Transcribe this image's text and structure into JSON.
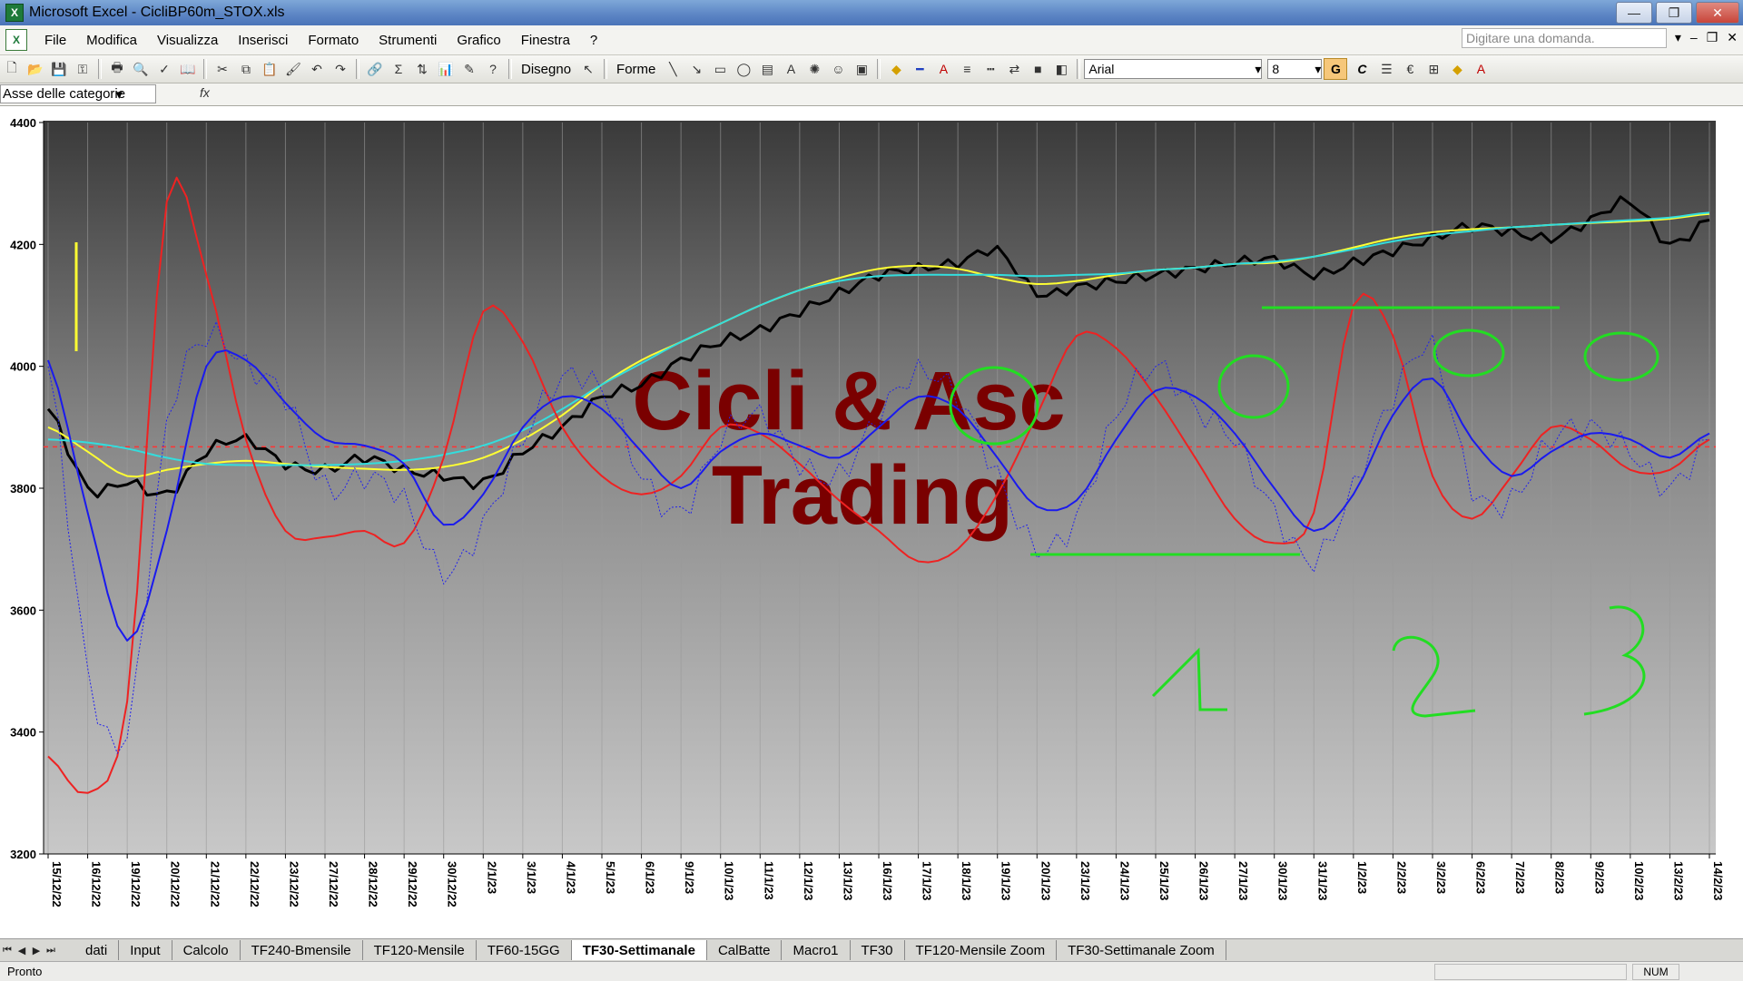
{
  "window": {
    "title": "Microsoft Excel - CicliBP60m_STOX.xls",
    "app_icon_letter": "X",
    "buttons": {
      "minimize": "—",
      "restore": "❐",
      "close": "✕"
    }
  },
  "menubar": {
    "items": [
      "File",
      "Modifica",
      "Visualizza",
      "Inserisci",
      "Formato",
      "Strumenti",
      "Grafico",
      "Finestra",
      "?"
    ],
    "question_placeholder": "Digitare una domanda.",
    "mdi_buttons": [
      "▾",
      "–",
      "❐",
      "✕"
    ]
  },
  "toolbar": {
    "draw_label": "Disegno",
    "shapes_label": "Forme",
    "font_name": "Arial",
    "font_size": "8",
    "bold_label": "G",
    "italic_label": "C",
    "euro_label": "€"
  },
  "formula_bar": {
    "name_box": "Asse delle categorie",
    "fx_label": "fx"
  },
  "chart_data": {
    "type": "line",
    "title": "",
    "watermark_lines": [
      "Cicli & Asc",
      "Trading"
    ],
    "ylim": [
      3200,
      4400
    ],
    "y_ticks": [
      "4400",
      "4200",
      "4000",
      "3800",
      "3600",
      "3400",
      "3200"
    ],
    "x_labels": [
      "15/12/22",
      "16/12/22",
      "19/12/22",
      "20/12/22",
      "21/12/22",
      "22/12/22",
      "23/12/22",
      "27/12/22",
      "28/12/22",
      "29/12/22",
      "30/12/22",
      "2/1/23",
      "3/1/23",
      "4/1/23",
      "5/1/23",
      "6/1/23",
      "9/1/23",
      "10/1/23",
      "11/1/23",
      "12/1/23",
      "13/1/23",
      "16/1/23",
      "17/1/23",
      "18/1/23",
      "19/1/23",
      "20/1/23",
      "23/1/23",
      "24/1/23",
      "25/1/23",
      "26/1/23",
      "27/1/23",
      "30/1/23",
      "31/1/23",
      "1/2/23",
      "2/2/23",
      "3/2/23",
      "6/2/23",
      "7/2/23",
      "8/2/23",
      "9/2/23",
      "10/2/23",
      "13/2/23",
      "14/2/23"
    ],
    "reference_line": 3868,
    "series": [
      {
        "color": "#000000",
        "style": "thick",
        "values": [
          3930,
          3800,
          3810,
          3790,
          3860,
          3880,
          3840,
          3830,
          3850,
          3830,
          3820,
          3810,
          3860,
          3900,
          3950,
          3970,
          4010,
          4040,
          4060,
          4090,
          4120,
          4150,
          4160,
          4170,
          4190,
          4120,
          4130,
          4140,
          4150,
          4160,
          4170,
          4175,
          4150,
          4170,
          4190,
          4210,
          4230,
          4220,
          4210,
          4240,
          4270,
          4200,
          4240
        ]
      },
      {
        "color": "#ffff33",
        "style": "smooth",
        "values": [
          3900,
          3860,
          3820,
          3830,
          3840,
          3845,
          3840,
          3835,
          3832,
          3830,
          3835,
          3850,
          3880,
          3920,
          3970,
          4010,
          4040,
          4070,
          4100,
          4125,
          4145,
          4160,
          4165,
          4160,
          4145,
          4135,
          4140,
          4150,
          4158,
          4162,
          4168,
          4170,
          4180,
          4195,
          4210,
          4220,
          4225,
          4228,
          4232,
          4235,
          4238,
          4242,
          4250
        ]
      },
      {
        "color": "#33dddd",
        "style": "smooth",
        "values": [
          3880,
          3875,
          3865,
          3850,
          3840,
          3838,
          3838,
          3838,
          3840,
          3845,
          3855,
          3870,
          3895,
          3930,
          3970,
          4005,
          4040,
          4070,
          4100,
          4125,
          4140,
          4148,
          4150,
          4150,
          4150,
          4148,
          4150,
          4152,
          4158,
          4162,
          4168,
          4172,
          4180,
          4192,
          4205,
          4215,
          4222,
          4228,
          4232,
          4236,
          4240,
          4244,
          4252
        ]
      },
      {
        "color": "#ee2222",
        "style": "normal",
        "values": [
          3360,
          3300,
          3450,
          4270,
          4150,
          3880,
          3730,
          3720,
          3730,
          3710,
          3850,
          4090,
          4040,
          3900,
          3820,
          3790,
          3820,
          3900,
          3890,
          3840,
          3780,
          3730,
          3680,
          3700,
          3790,
          3920,
          4050,
          4030,
          3950,
          3850,
          3750,
          3710,
          3760,
          4100,
          4050,
          3820,
          3750,
          3820,
          3900,
          3880,
          3830,
          3830,
          3880
        ]
      },
      {
        "color": "#1a1aee",
        "style": "normal",
        "values": [
          4010,
          3760,
          3550,
          3730,
          4000,
          4010,
          3940,
          3880,
          3870,
          3840,
          3740,
          3790,
          3900,
          3950,
          3930,
          3860,
          3800,
          3860,
          3890,
          3870,
          3850,
          3900,
          3950,
          3930,
          3850,
          3770,
          3780,
          3880,
          3960,
          3950,
          3890,
          3800,
          3730,
          3790,
          3920,
          3980,
          3880,
          3820,
          3860,
          3890,
          3880,
          3850,
          3890
        ]
      },
      {
        "color": "#2222ee",
        "style": "dotted",
        "values": [
          4000,
          3500,
          3400,
          3900,
          4050,
          4000,
          3950,
          3800,
          3820,
          3780,
          3660,
          3740,
          3880,
          3980,
          3960,
          3820,
          3760,
          3880,
          3920,
          3840,
          3820,
          3920,
          3990,
          3950,
          3820,
          3700,
          3750,
          3920,
          4000,
          3930,
          3880,
          3760,
          3680,
          3800,
          3950,
          4030,
          3800,
          3780,
          3880,
          3900,
          3860,
          3800,
          3880
        ]
      }
    ],
    "annotations": [
      {
        "text": "1",
        "color": "#22dd22"
      },
      {
        "text": "2",
        "color": "#22dd22"
      },
      {
        "text": "3",
        "color": "#22dd22"
      }
    ]
  },
  "sheet_tabs": {
    "nav": [
      "⏮",
      "◀",
      "▶",
      "⏭"
    ],
    "tabs": [
      "dati",
      "Input",
      "Calcolo",
      "TF240-Bmensile",
      "TF120-Mensile",
      "TF60-15GG",
      "TF30-Settimanale",
      "CalBatte",
      "Macro1",
      "TF30",
      "TF120-Mensile Zoom",
      "TF30-Settimanale Zoom"
    ],
    "active": "TF30-Settimanale"
  },
  "statusbar": {
    "status": "Pronto",
    "num_indicator": "NUM"
  }
}
